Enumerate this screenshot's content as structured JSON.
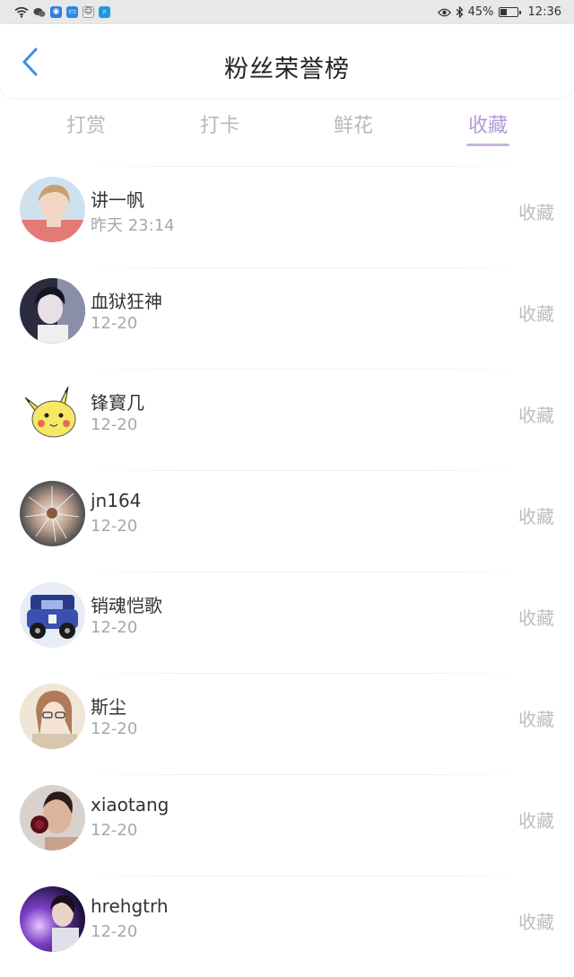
{
  "status_bar": {
    "battery": "45%",
    "time": "12:36",
    "battery_level": 0.45
  },
  "header": {
    "title": "粉丝荣誉榜"
  },
  "tabs": [
    {
      "label": "打赏",
      "active": false
    },
    {
      "label": "打卡",
      "active": false
    },
    {
      "label": "鲜花",
      "active": false
    },
    {
      "label": "收藏",
      "active": true
    }
  ],
  "colors": {
    "accent": "#b39ad6",
    "back": "#3f8fe0",
    "muted": "#bdbdbd"
  },
  "fans": [
    {
      "name": "讲一帆",
      "time": "昨天 23:14",
      "action": "收藏",
      "avatar": "avatar-girl-pink"
    },
    {
      "name": "血狱狂神",
      "time": "12-20",
      "action": "收藏",
      "avatar": "avatar-dark-portrait"
    },
    {
      "name": "锋寳几",
      "time": "12-20",
      "action": "收藏",
      "avatar": "avatar-pikachu"
    },
    {
      "name": "jn164",
      "time": "12-20",
      "action": "收藏",
      "avatar": "avatar-dandelion"
    },
    {
      "name": "销魂恺歌",
      "time": "12-20",
      "action": "收藏",
      "avatar": "avatar-toy-car"
    },
    {
      "name": "斯尘",
      "time": "12-20",
      "action": "收藏",
      "avatar": "avatar-girl-glasses"
    },
    {
      "name": "xiaotang",
      "time": "12-20",
      "action": "收藏",
      "avatar": "avatar-man-rose"
    },
    {
      "name": "hrehgtrh",
      "time": "12-20",
      "action": "收藏",
      "avatar": "avatar-man-purple"
    }
  ]
}
